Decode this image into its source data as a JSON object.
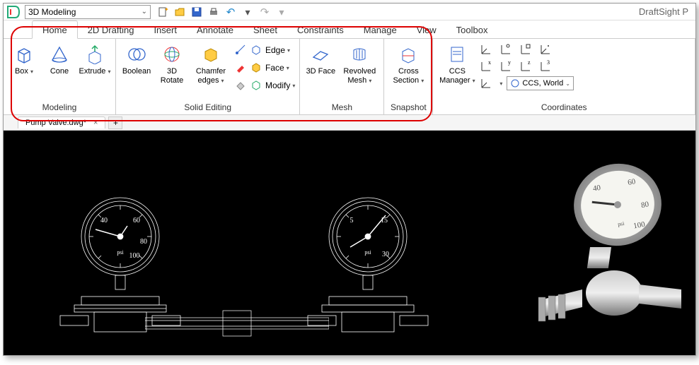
{
  "app": {
    "name": "DraftSight P"
  },
  "workspace": {
    "selected": "3D Modeling"
  },
  "qat": {
    "new": "new-icon",
    "open": "open-icon",
    "save": "save-icon",
    "print": "print-icon",
    "undo": "undo-icon",
    "redo": "redo-icon"
  },
  "tabs": [
    {
      "label": "Home",
      "active": true
    },
    {
      "label": "2D Drafting",
      "active": false
    },
    {
      "label": "Insert",
      "active": false
    },
    {
      "label": "Annotate",
      "active": false
    },
    {
      "label": "Sheet",
      "active": false
    },
    {
      "label": "Constraints",
      "active": false
    },
    {
      "label": "Manage",
      "active": false
    },
    {
      "label": "View",
      "active": false
    },
    {
      "label": "Toolbox",
      "active": false
    }
  ],
  "ribbon": {
    "modeling": {
      "title": "Modeling",
      "items": [
        {
          "label": "Box",
          "arrow": true
        },
        {
          "label": "Cone",
          "arrow": false
        },
        {
          "label": "Extrude",
          "arrow": true
        }
      ]
    },
    "solid_editing": {
      "title": "Solid Editing",
      "big": [
        {
          "label": "Boolean",
          "arrow": false
        },
        {
          "label": "3D Rotate",
          "arrow": false
        },
        {
          "label": "Chamfer\nedges",
          "arrow": true
        }
      ],
      "rows": [
        {
          "label": "Edge",
          "arrow": true
        },
        {
          "label": "Face",
          "arrow": true
        },
        {
          "label": "Modify",
          "arrow": true
        }
      ]
    },
    "mesh": {
      "title": "Mesh",
      "items": [
        {
          "label": "3D Face",
          "arrow": false
        },
        {
          "label": "Revolved\nMesh",
          "arrow": true
        }
      ]
    },
    "snapshot": {
      "title": "Snapshot",
      "items": [
        {
          "label": "Cross\nSection",
          "arrow": true
        }
      ]
    },
    "coordinates": {
      "title": "Coordinates",
      "manager": "CCS\nManager",
      "selected": "CCS, World"
    }
  },
  "file_tab": {
    "name": "Pump Valve.dwg*"
  },
  "gauge_left": {
    "ticks": [
      "40",
      "60",
      "80",
      "100"
    ],
    "unit": "psi"
  },
  "gauge_mid": {
    "ticks": [
      "5",
      "15",
      "30"
    ],
    "unit": "psi"
  },
  "gauge_right": {
    "ticks": [
      "40",
      "60",
      "80",
      "100"
    ],
    "unit": "psi"
  }
}
